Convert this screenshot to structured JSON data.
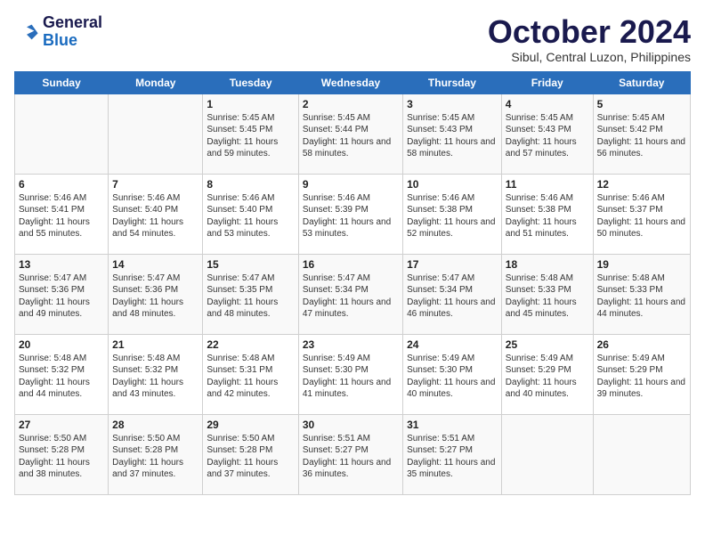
{
  "header": {
    "logo_line1": "General",
    "logo_line2": "Blue",
    "month": "October 2024",
    "location": "Sibul, Central Luzon, Philippines"
  },
  "days_of_week": [
    "Sunday",
    "Monday",
    "Tuesday",
    "Wednesday",
    "Thursday",
    "Friday",
    "Saturday"
  ],
  "weeks": [
    [
      {
        "day": "",
        "info": ""
      },
      {
        "day": "",
        "info": ""
      },
      {
        "day": "1",
        "sunrise": "5:45 AM",
        "sunset": "5:45 PM",
        "daylight": "11 hours and 59 minutes."
      },
      {
        "day": "2",
        "sunrise": "5:45 AM",
        "sunset": "5:44 PM",
        "daylight": "11 hours and 58 minutes."
      },
      {
        "day": "3",
        "sunrise": "5:45 AM",
        "sunset": "5:43 PM",
        "daylight": "11 hours and 58 minutes."
      },
      {
        "day": "4",
        "sunrise": "5:45 AM",
        "sunset": "5:43 PM",
        "daylight": "11 hours and 57 minutes."
      },
      {
        "day": "5",
        "sunrise": "5:45 AM",
        "sunset": "5:42 PM",
        "daylight": "11 hours and 56 minutes."
      }
    ],
    [
      {
        "day": "6",
        "sunrise": "5:46 AM",
        "sunset": "5:41 PM",
        "daylight": "11 hours and 55 minutes."
      },
      {
        "day": "7",
        "sunrise": "5:46 AM",
        "sunset": "5:40 PM",
        "daylight": "11 hours and 54 minutes."
      },
      {
        "day": "8",
        "sunrise": "5:46 AM",
        "sunset": "5:40 PM",
        "daylight": "11 hours and 53 minutes."
      },
      {
        "day": "9",
        "sunrise": "5:46 AM",
        "sunset": "5:39 PM",
        "daylight": "11 hours and 53 minutes."
      },
      {
        "day": "10",
        "sunrise": "5:46 AM",
        "sunset": "5:38 PM",
        "daylight": "11 hours and 52 minutes."
      },
      {
        "day": "11",
        "sunrise": "5:46 AM",
        "sunset": "5:38 PM",
        "daylight": "11 hours and 51 minutes."
      },
      {
        "day": "12",
        "sunrise": "5:46 AM",
        "sunset": "5:37 PM",
        "daylight": "11 hours and 50 minutes."
      }
    ],
    [
      {
        "day": "13",
        "sunrise": "5:47 AM",
        "sunset": "5:36 PM",
        "daylight": "11 hours and 49 minutes."
      },
      {
        "day": "14",
        "sunrise": "5:47 AM",
        "sunset": "5:36 PM",
        "daylight": "11 hours and 48 minutes."
      },
      {
        "day": "15",
        "sunrise": "5:47 AM",
        "sunset": "5:35 PM",
        "daylight": "11 hours and 48 minutes."
      },
      {
        "day": "16",
        "sunrise": "5:47 AM",
        "sunset": "5:34 PM",
        "daylight": "11 hours and 47 minutes."
      },
      {
        "day": "17",
        "sunrise": "5:47 AM",
        "sunset": "5:34 PM",
        "daylight": "11 hours and 46 minutes."
      },
      {
        "day": "18",
        "sunrise": "5:48 AM",
        "sunset": "5:33 PM",
        "daylight": "11 hours and 45 minutes."
      },
      {
        "day": "19",
        "sunrise": "5:48 AM",
        "sunset": "5:33 PM",
        "daylight": "11 hours and 44 minutes."
      }
    ],
    [
      {
        "day": "20",
        "sunrise": "5:48 AM",
        "sunset": "5:32 PM",
        "daylight": "11 hours and 44 minutes."
      },
      {
        "day": "21",
        "sunrise": "5:48 AM",
        "sunset": "5:32 PM",
        "daylight": "11 hours and 43 minutes."
      },
      {
        "day": "22",
        "sunrise": "5:48 AM",
        "sunset": "5:31 PM",
        "daylight": "11 hours and 42 minutes."
      },
      {
        "day": "23",
        "sunrise": "5:49 AM",
        "sunset": "5:30 PM",
        "daylight": "11 hours and 41 minutes."
      },
      {
        "day": "24",
        "sunrise": "5:49 AM",
        "sunset": "5:30 PM",
        "daylight": "11 hours and 40 minutes."
      },
      {
        "day": "25",
        "sunrise": "5:49 AM",
        "sunset": "5:29 PM",
        "daylight": "11 hours and 40 minutes."
      },
      {
        "day": "26",
        "sunrise": "5:49 AM",
        "sunset": "5:29 PM",
        "daylight": "11 hours and 39 minutes."
      }
    ],
    [
      {
        "day": "27",
        "sunrise": "5:50 AM",
        "sunset": "5:28 PM",
        "daylight": "11 hours and 38 minutes."
      },
      {
        "day": "28",
        "sunrise": "5:50 AM",
        "sunset": "5:28 PM",
        "daylight": "11 hours and 37 minutes."
      },
      {
        "day": "29",
        "sunrise": "5:50 AM",
        "sunset": "5:28 PM",
        "daylight": "11 hours and 37 minutes."
      },
      {
        "day": "30",
        "sunrise": "5:51 AM",
        "sunset": "5:27 PM",
        "daylight": "11 hours and 36 minutes."
      },
      {
        "day": "31",
        "sunrise": "5:51 AM",
        "sunset": "5:27 PM",
        "daylight": "11 hours and 35 minutes."
      },
      {
        "day": "",
        "info": ""
      },
      {
        "day": "",
        "info": ""
      }
    ]
  ]
}
